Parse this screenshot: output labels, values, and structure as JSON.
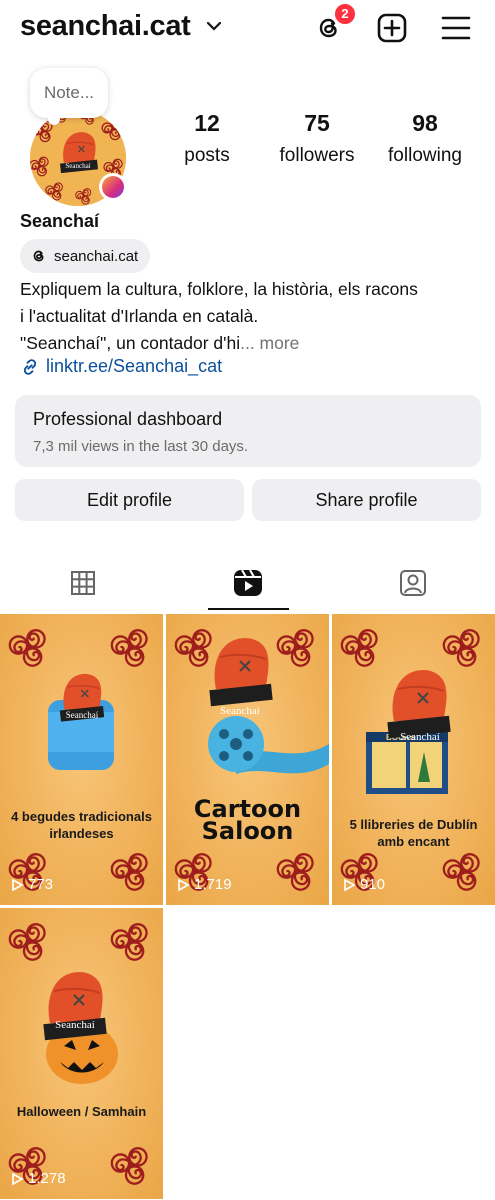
{
  "header": {
    "username": "seanchai.cat",
    "notification_count": "2"
  },
  "note": {
    "placeholder": "Note..."
  },
  "stats": [
    {
      "value": "12",
      "label": "posts"
    },
    {
      "value": "75",
      "label": "followers"
    },
    {
      "value": "98",
      "label": "following"
    }
  ],
  "profile": {
    "display_name": "Seanchaí",
    "threads_handle": "seanchai.cat",
    "bio_line1": "Expliquem la cultura, folklore, la història, els racons",
    "bio_line2": "i l'actualitat d'Irlanda en català.",
    "bio_line3": "\"Seanchaí\", un contador d'hi",
    "bio_more": "... more",
    "link": "linktr.ee/Seanchai_cat",
    "hat_label": "Seanchaí"
  },
  "dashboard": {
    "title": "Professional dashboard",
    "subtitle": "7,3 mil views in the last 30 days."
  },
  "buttons": {
    "edit": "Edit profile",
    "share": "Share profile"
  },
  "reels": [
    {
      "title": "4 begudes tradicionals irlandeses",
      "views": "773"
    },
    {
      "title": "Cartoon Saloon",
      "views": "1.719"
    },
    {
      "title": "5 llibreries de Dublín amb encant",
      "views": "910",
      "shop_sign": "BOOKS"
    },
    {
      "title": "Halloween / Samhain",
      "views": "1.278"
    }
  ],
  "colors": {
    "tile_bg": "#f1b35c",
    "hat": "#e2502a",
    "triskele": "#9e1d1d",
    "link": "#0b4f9c",
    "badge": "#ff3040"
  }
}
